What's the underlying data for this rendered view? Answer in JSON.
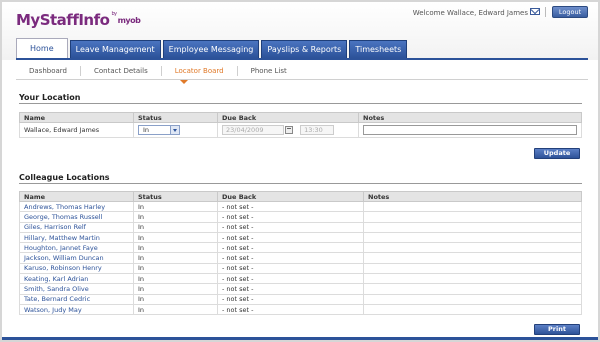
{
  "header": {
    "logo_text": "MyStaffInfo",
    "logo_by": "by",
    "logo_brand": "myob",
    "welcome": "Welcome Wallace, Edward James",
    "logout_label": "Logout"
  },
  "tabs": [
    {
      "label": "Home",
      "active": true
    },
    {
      "label": "Leave Management",
      "active": false
    },
    {
      "label": "Employee Messaging",
      "active": false
    },
    {
      "label": "Payslips & Reports",
      "active": false
    },
    {
      "label": "Timesheets",
      "active": false
    }
  ],
  "subnav": [
    {
      "label": "Dashboard",
      "active": false
    },
    {
      "label": "Contact Details",
      "active": false
    },
    {
      "label": "Locator Board",
      "active": true
    },
    {
      "label": "Phone List",
      "active": false
    }
  ],
  "your_location": {
    "title": "Your Location",
    "headers": [
      "Name",
      "Status",
      "Due Back",
      "Notes"
    ],
    "name": "Wallace, Edward James",
    "status": "In",
    "due_date": "23/04/2009",
    "due_time": "13:30",
    "notes": "",
    "update_label": "Update"
  },
  "colleagues": {
    "title": "Colleague Locations",
    "headers": [
      "Name",
      "Status",
      "Due Back",
      "Notes"
    ],
    "rows": [
      {
        "name": "Andrews, Thomas Harley",
        "status": "In",
        "due": "- not set -",
        "notes": ""
      },
      {
        "name": "George, Thomas Russell",
        "status": "In",
        "due": "- not set -",
        "notes": ""
      },
      {
        "name": "Giles, Harrison Relf",
        "status": "In",
        "due": "- not set -",
        "notes": ""
      },
      {
        "name": "Hillary, Matthew Martin",
        "status": "In",
        "due": "- not set -",
        "notes": ""
      },
      {
        "name": "Houghton, Jannet Faye",
        "status": "In",
        "due": "- not set -",
        "notes": ""
      },
      {
        "name": "Jackson, William Duncan",
        "status": "In",
        "due": "- not set -",
        "notes": ""
      },
      {
        "name": "Karuso, Robinson Henry",
        "status": "In",
        "due": "- not set -",
        "notes": ""
      },
      {
        "name": "Keating, Karl Adrian",
        "status": "In",
        "due": "- not set -",
        "notes": ""
      },
      {
        "name": "Smith, Sandra Olive",
        "status": "In",
        "due": "- not set -",
        "notes": ""
      },
      {
        "name": "Tate, Bernard Cedric",
        "status": "In",
        "due": "- not set -",
        "notes": ""
      },
      {
        "name": "Watson, Judy May",
        "status": "In",
        "due": "- not set -",
        "notes": ""
      }
    ],
    "print_label": "Print"
  },
  "colors": {
    "brand": "#7b2b7e",
    "nav_blue": "#2c5299",
    "active_sub": "#e07a2a"
  }
}
